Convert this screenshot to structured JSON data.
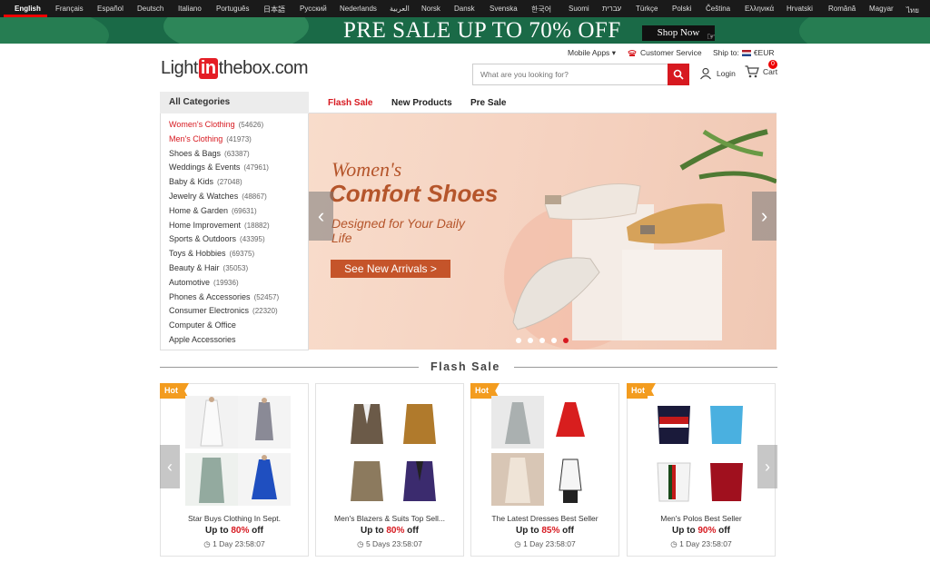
{
  "languages": [
    "English",
    "Français",
    "Español",
    "Deutsch",
    "Italiano",
    "Português",
    "日本語",
    "Русский",
    "Nederlands",
    "العربية",
    "Norsk",
    "Dansk",
    "Svenska",
    "한국어",
    "Suomi",
    "עברית",
    "Türkçe",
    "Polski",
    "Čeština",
    "Ελληνικά",
    "Hrvatski",
    "Română",
    "Magyar",
    "ไทย"
  ],
  "promo": {
    "text": "PRE SALE UP TO 70% OFF",
    "cta": "Shop Now"
  },
  "header": {
    "mobile_apps": "Mobile Apps",
    "customer_service": "Customer Service",
    "ship_to": "Ship to:",
    "currency": "€EUR",
    "search_placeholder": "What are you looking for?",
    "login": "Login",
    "cart": "Cart",
    "cart_count": "0",
    "logo_light": "Light",
    "logo_in": "in",
    "logo_rest": "thebox.com"
  },
  "categories": {
    "title": "All Categories",
    "items": [
      {
        "label": "Women's Clothing",
        "count": "(54626)",
        "highlight": true
      },
      {
        "label": "Men's Clothing",
        "count": "(41973)",
        "highlight": true
      },
      {
        "label": "Shoes & Bags",
        "count": "(63387)"
      },
      {
        "label": "Weddings & Events",
        "count": "(47961)"
      },
      {
        "label": "Baby & Kids",
        "count": "(27048)"
      },
      {
        "label": "Jewelry & Watches",
        "count": "(48867)"
      },
      {
        "label": "Home & Garden",
        "count": "(69631)"
      },
      {
        "label": "Home Improvement",
        "count": "(18882)"
      },
      {
        "label": "Sports & Outdoors",
        "count": "(43395)"
      },
      {
        "label": "Toys & Hobbies",
        "count": "(69375)"
      },
      {
        "label": "Beauty & Hair",
        "count": "(35053)"
      },
      {
        "label": "Automotive",
        "count": "(19936)"
      },
      {
        "label": "Phones & Accessories",
        "count": "(52457)"
      },
      {
        "label": "Consumer Electronics",
        "count": "(22320)"
      },
      {
        "label": "Computer & Office",
        "count": ""
      },
      {
        "label": "Apple Accessories",
        "count": ""
      }
    ]
  },
  "tabs": [
    {
      "label": "Flash Sale"
    },
    {
      "label": "New Products"
    },
    {
      "label": "Pre Sale"
    }
  ],
  "hero": {
    "title1": "Women's",
    "title2": "Comfort Shoes",
    "subtitle": "Designed for Your Daily Life",
    "cta": "See New Arrivals >",
    "slides": 5,
    "active_slide": 5
  },
  "flash_sale": {
    "title": "Flash Sale",
    "cards": [
      {
        "hot": "Hot",
        "name": "Star Buys Clothing In Sept.",
        "price_prefix": "Up to ",
        "pct": "80%",
        "price_suffix": " off",
        "time": "1 Day 23:58:07"
      },
      {
        "hot": "",
        "name": "Men's Blazers & Suits Top Sell...",
        "price_prefix": "Up to ",
        "pct": "80%",
        "price_suffix": " off",
        "time": "5 Days 23:58:07"
      },
      {
        "hot": "Hot",
        "name": "The Latest Dresses Best Seller",
        "price_prefix": "Up to ",
        "pct": "85%",
        "price_suffix": " off",
        "time": "1 Day 23:58:07"
      },
      {
        "hot": "Hot",
        "name": "Men's Polos Best Seller",
        "price_prefix": "Up to ",
        "pct": "90%",
        "price_suffix": " off",
        "time": "1 Day 23:58:07"
      }
    ]
  },
  "colors": {
    "accent": "#d71920",
    "hot": "#f39c1f",
    "promo_bg": "#1a6a47"
  }
}
